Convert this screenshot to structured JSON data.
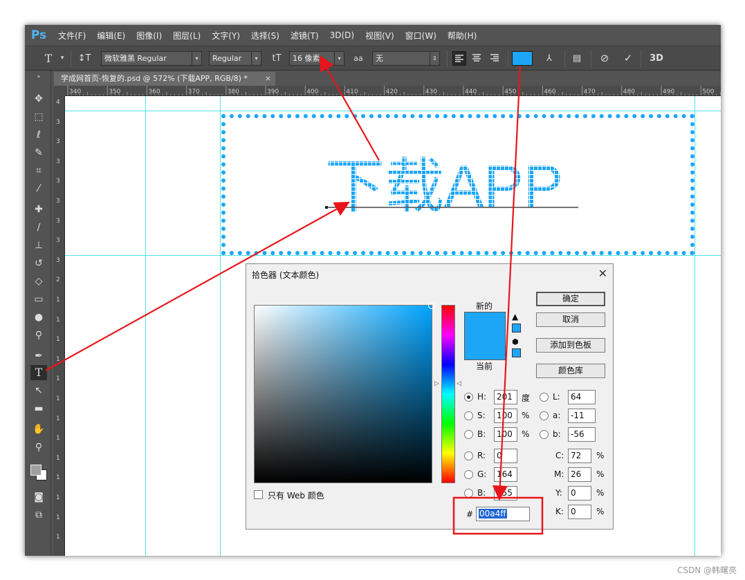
{
  "app": {
    "logo": "Ps",
    "menu": [
      "文件(F)",
      "编辑(E)",
      "图像(I)",
      "图层(L)",
      "文字(Y)",
      "选择(S)",
      "滤镜(T)",
      "3D(D)",
      "视图(V)",
      "窗口(W)",
      "帮助(H)"
    ]
  },
  "options": {
    "font_family": "微软雅黑 Regular",
    "font_style": "Regular",
    "font_size": "16 像素",
    "antialias_icon": "aa",
    "antialias": "无",
    "text_color": "#1ea6f6",
    "three_d": "3D"
  },
  "document": {
    "tab_title": "学成网首页-恢复的.psd @ 572% (下载APP, RGB/8) *",
    "tab_close": "×",
    "ruler_top": [
      "340",
      "350",
      "360",
      "370",
      "380",
      "390",
      "400",
      "410",
      "420",
      "430",
      "440",
      "450",
      "460",
      "470",
      "480",
      "490",
      "500"
    ],
    "ruler_left": [
      "4",
      "3",
      "3",
      "3",
      "3",
      "3",
      "3",
      "3",
      "3",
      "2",
      "1",
      "1",
      "1",
      "1",
      "1",
      "1",
      "1",
      "1",
      "1",
      "1",
      "1",
      "1",
      "1"
    ],
    "canvas_text": "下载APP",
    "pixel_color": "#1ea6f6"
  },
  "dialog": {
    "title": "拾色器 (文本颜色)",
    "close": "✕",
    "new_label": "新的",
    "current_label": "当前",
    "new_color": "#1ea6f6",
    "current_color": "#1ea6f6",
    "buttons": {
      "ok": "确定",
      "cancel": "取消",
      "add_swatch": "添加到色板",
      "color_library": "颜色库"
    },
    "hsb": [
      {
        "label": "H:",
        "value": "201",
        "unit": "度",
        "selected": true
      },
      {
        "label": "S:",
        "value": "100",
        "unit": "%",
        "selected": false
      },
      {
        "label": "B:",
        "value": "100",
        "unit": "%",
        "selected": false
      }
    ],
    "rgb": [
      {
        "label": "R:",
        "value": "0"
      },
      {
        "label": "G:",
        "value": "164"
      },
      {
        "label": "B:",
        "value": "255"
      }
    ],
    "lab": [
      {
        "label": "L:",
        "value": "64"
      },
      {
        "label": "a:",
        "value": "-11"
      },
      {
        "label": "b:",
        "value": "-56"
      }
    ],
    "cmyk": [
      {
        "label": "C:",
        "value": "72",
        "unit": "%"
      },
      {
        "label": "M:",
        "value": "26",
        "unit": "%"
      },
      {
        "label": "Y:",
        "value": "0",
        "unit": "%"
      },
      {
        "label": "K:",
        "value": "0",
        "unit": "%"
      }
    ],
    "hex_label": "#",
    "hex_value": "00a4ff",
    "web_only_label": "只有 Web 颜色"
  },
  "watermark": "CSDN @韩曙亮"
}
